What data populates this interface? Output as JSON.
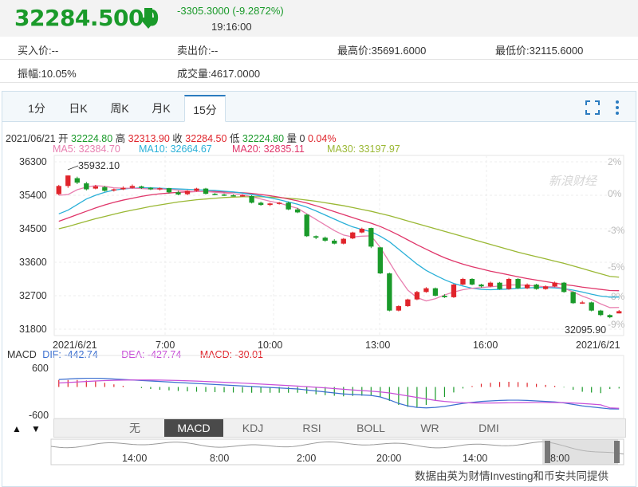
{
  "quote": {
    "price": "32284.5000",
    "change": "-3305.3000 (-9.2872%)",
    "time": "19:16:00"
  },
  "info": {
    "bid": "买入价:--",
    "ask": "卖出价:--",
    "high": "最高价:35691.6000",
    "low": "最低价:32115.6000",
    "amplitude": "振幅:10.05%",
    "volume": "成交量:4617.0000"
  },
  "tabs": [
    "1分",
    "日K",
    "周K",
    "月K",
    "15分"
  ],
  "active_tab": "15分",
  "ohlc": {
    "date": "2021/06/21",
    "open_label": "开",
    "open": "32224.80",
    "high_label": "高",
    "high": "32313.90",
    "close_label": "收",
    "close": "32284.50",
    "low_label": "低",
    "low": "32224.80",
    "vol_label": "量",
    "vol": "0",
    "pct": "0.04%"
  },
  "ma": {
    "ma5": "MA5: 32384.70",
    "ma10": "MA10: 32664.67",
    "ma20": "MA20: 32835.11",
    "ma30": "MA30: 33197.97"
  },
  "macd": {
    "title": "MACD",
    "dif": "DIF: -442.74",
    "dea": "DEA: -427.74",
    "macd": "MACD: -30.01",
    "ytick_top": "600",
    "ytick_bottom": "-600"
  },
  "indicators": [
    "无",
    "MACD",
    "KDJ",
    "RSI",
    "BOLL",
    "WR",
    "DMI"
  ],
  "active_indicator": "MACD",
  "nav_labels": [
    "14:00",
    "8:00",
    "2:00",
    "20:00",
    "14:00",
    "8:00"
  ],
  "footer": "数据由英为财情Investing和币安共同提供",
  "watermark": "新浪财经",
  "colors": {
    "up": "#e0242b",
    "down": "#1a9a2a",
    "ma5": "#e87fb0",
    "ma10": "#2ab0d8",
    "ma20": "#e0366a",
    "ma30": "#9ab834"
  },
  "chart_data": {
    "type": "candlestick",
    "y_ticks": [
      "36300",
      "35400",
      "34500",
      "33600",
      "32700",
      "31800"
    ],
    "y_pct_ticks": [
      "2%",
      "0%",
      "-3%",
      "-5%",
      "-8%",
      "-9%"
    ],
    "x_labels": [
      "2021/6/21",
      "7:00",
      "10:00",
      "13:00",
      "16:00",
      "2021/6/21"
    ],
    "annotations": [
      "35932.10",
      "32095.90"
    ],
    "ylim": [
      31800,
      36300
    ],
    "candles": [
      {
        "o": 35430,
        "c": 35650,
        "h": 35680,
        "l": 35400
      },
      {
        "o": 35650,
        "c": 35932,
        "h": 35932,
        "l": 35600
      },
      {
        "o": 35860,
        "c": 35740,
        "h": 35900,
        "l": 35700
      },
      {
        "o": 35720,
        "c": 35560,
        "h": 35760,
        "l": 35530
      },
      {
        "o": 35580,
        "c": 35640,
        "h": 35680,
        "l": 35560
      },
      {
        "o": 35620,
        "c": 35520,
        "h": 35650,
        "l": 35500
      },
      {
        "o": 35530,
        "c": 35560,
        "h": 35580,
        "l": 35500
      },
      {
        "o": 35560,
        "c": 35600,
        "h": 35640,
        "l": 35540
      },
      {
        "o": 35600,
        "c": 35650,
        "h": 35690,
        "l": 35580
      },
      {
        "o": 35640,
        "c": 35600,
        "h": 35660,
        "l": 35570
      },
      {
        "o": 35600,
        "c": 35560,
        "h": 35620,
        "l": 35540
      },
      {
        "o": 35560,
        "c": 35590,
        "h": 35610,
        "l": 35530
      },
      {
        "o": 35590,
        "c": 35480,
        "h": 35600,
        "l": 35450
      },
      {
        "o": 35480,
        "c": 35420,
        "h": 35520,
        "l": 35400
      },
      {
        "o": 35430,
        "c": 35520,
        "h": 35540,
        "l": 35400
      },
      {
        "o": 35520,
        "c": 35580,
        "h": 35600,
        "l": 35500
      },
      {
        "o": 35580,
        "c": 35440,
        "h": 35600,
        "l": 35420
      },
      {
        "o": 35440,
        "c": 35420,
        "h": 35460,
        "l": 35400
      },
      {
        "o": 35420,
        "c": 35400,
        "h": 35440,
        "l": 35380
      },
      {
        "o": 35400,
        "c": 35390,
        "h": 35420,
        "l": 35370
      },
      {
        "o": 35390,
        "c": 35400,
        "h": 35420,
        "l": 35360
      },
      {
        "o": 35380,
        "c": 35200,
        "h": 35400,
        "l": 35180
      },
      {
        "o": 35200,
        "c": 35140,
        "h": 35230,
        "l": 35120
      },
      {
        "o": 35140,
        "c": 35180,
        "h": 35200,
        "l": 35110
      },
      {
        "o": 35180,
        "c": 35200,
        "h": 35220,
        "l": 35150
      },
      {
        "o": 35200,
        "c": 35020,
        "h": 35230,
        "l": 35000
      },
      {
        "o": 35020,
        "c": 34940,
        "h": 35060,
        "l": 34920
      },
      {
        "o": 34880,
        "c": 34300,
        "h": 34900,
        "l": 34280
      },
      {
        "o": 34300,
        "c": 34260,
        "h": 34320,
        "l": 34220
      },
      {
        "o": 34260,
        "c": 34180,
        "h": 34290,
        "l": 34150
      },
      {
        "o": 34180,
        "c": 34100,
        "h": 34220,
        "l": 34080
      },
      {
        "o": 34100,
        "c": 34230,
        "h": 34250,
        "l": 34080
      },
      {
        "o": 34240,
        "c": 34400,
        "h": 34420,
        "l": 34220
      },
      {
        "o": 34400,
        "c": 34500,
        "h": 34530,
        "l": 34380
      },
      {
        "o": 34520,
        "c": 34020,
        "h": 34530,
        "l": 33980
      },
      {
        "o": 34000,
        "c": 33300,
        "h": 34010,
        "l": 33280
      },
      {
        "o": 33300,
        "c": 32300,
        "h": 33320,
        "l": 32280
      },
      {
        "o": 32300,
        "c": 32420,
        "h": 32440,
        "l": 32280
      },
      {
        "o": 32420,
        "c": 32600,
        "h": 32620,
        "l": 32400
      },
      {
        "o": 32600,
        "c": 32800,
        "h": 32830,
        "l": 32580
      },
      {
        "o": 32800,
        "c": 32900,
        "h": 32930,
        "l": 32780
      },
      {
        "o": 32900,
        "c": 32700,
        "h": 32920,
        "l": 32680
      },
      {
        "o": 32700,
        "c": 32660,
        "h": 32740,
        "l": 32640
      },
      {
        "o": 32660,
        "c": 33000,
        "h": 33020,
        "l": 32640
      },
      {
        "o": 33000,
        "c": 33150,
        "h": 33180,
        "l": 32980
      },
      {
        "o": 33150,
        "c": 33000,
        "h": 33170,
        "l": 32980
      },
      {
        "o": 33000,
        "c": 32950,
        "h": 33020,
        "l": 32920
      },
      {
        "o": 32950,
        "c": 33050,
        "h": 33080,
        "l": 32930
      },
      {
        "o": 33050,
        "c": 32880,
        "h": 33070,
        "l": 32860
      },
      {
        "o": 32880,
        "c": 33150,
        "h": 33180,
        "l": 32860
      },
      {
        "o": 33150,
        "c": 32900,
        "h": 33170,
        "l": 32880
      },
      {
        "o": 32900,
        "c": 33000,
        "h": 33030,
        "l": 32880
      },
      {
        "o": 33000,
        "c": 32880,
        "h": 33020,
        "l": 32860
      },
      {
        "o": 32880,
        "c": 32950,
        "h": 32980,
        "l": 32860
      },
      {
        "o": 32950,
        "c": 33050,
        "h": 33080,
        "l": 32930
      },
      {
        "o": 33050,
        "c": 32800,
        "h": 33070,
        "l": 32780
      },
      {
        "o": 32800,
        "c": 32500,
        "h": 32820,
        "l": 32480
      },
      {
        "o": 32500,
        "c": 32520,
        "h": 32560,
        "l": 32480
      },
      {
        "o": 32520,
        "c": 32300,
        "h": 32540,
        "l": 32280
      },
      {
        "o": 32300,
        "c": 32180,
        "h": 32320,
        "l": 32150
      },
      {
        "o": 32180,
        "c": 32120,
        "h": 32200,
        "l": 32095
      },
      {
        "o": 32224,
        "c": 32284,
        "h": 32314,
        "l": 32224
      }
    ],
    "ma5": [
      35400,
      35420,
      35550,
      35620,
      35660,
      35640,
      35600,
      35590,
      35590,
      35580,
      35570,
      35570,
      35560,
      35540,
      35510,
      35500,
      35500,
      35480,
      35460,
      35440,
      35420,
      35360,
      35300,
      35240,
      35190,
      35120,
      35050,
      34900,
      34750,
      34600,
      34450,
      34330,
      34280,
      34300,
      34310,
      34000,
      33600,
      33200,
      32850,
      32650,
      32560,
      32620,
      32720,
      32800,
      32860,
      32900,
      32920,
      32940,
      32960,
      32990,
      32990,
      32980,
      32960,
      32940,
      32940,
      32900,
      32800,
      32690,
      32600,
      32480,
      32380,
      32384
    ],
    "ma10": [
      34900,
      35000,
      35150,
      35300,
      35400,
      35480,
      35540,
      35570,
      35590,
      35600,
      35600,
      35590,
      35580,
      35570,
      35560,
      35550,
      35540,
      35530,
      35510,
      35490,
      35460,
      35420,
      35380,
      35330,
      35280,
      35220,
      35160,
      35080,
      34980,
      34870,
      34760,
      34650,
      34550,
      34480,
      34420,
      34300,
      34150,
      33950,
      33750,
      33550,
      33380,
      33250,
      33130,
      33030,
      32960,
      32900,
      32870,
      32860,
      32870,
      32880,
      32900,
      32910,
      32920,
      32920,
      32910,
      32890,
      32850,
      32800,
      32740,
      32690,
      32664,
      32664
    ],
    "ma20": [
      34700,
      34790,
      34880,
      34970,
      35060,
      35140,
      35210,
      35270,
      35320,
      35370,
      35410,
      35440,
      35460,
      35480,
      35490,
      35500,
      35500,
      35500,
      35490,
      35480,
      35470,
      35450,
      35420,
      35390,
      35350,
      35300,
      35250,
      35190,
      35120,
      35040,
      34960,
      34880,
      34800,
      34720,
      34650,
      34560,
      34450,
      34330,
      34200,
      34070,
      33950,
      33830,
      33720,
      33630,
      33550,
      33480,
      33420,
      33360,
      33310,
      33260,
      33210,
      33160,
      33120,
      33080,
      33040,
      33000,
      32970,
      32930,
      32900,
      32870,
      32840,
      32835
    ],
    "ma30": [
      34500,
      34560,
      34630,
      34700,
      34770,
      34830,
      34890,
      34950,
      35000,
      35050,
      35100,
      35140,
      35180,
      35220,
      35250,
      35280,
      35300,
      35320,
      35340,
      35350,
      35360,
      35360,
      35360,
      35350,
      35340,
      35320,
      35300,
      35270,
      35240,
      35200,
      35160,
      35120,
      35070,
      35020,
      34970,
      34910,
      34850,
      34780,
      34710,
      34640,
      34570,
      34500,
      34430,
      34360,
      34290,
      34220,
      34150,
      34080,
      34010,
      33940,
      33870,
      33810,
      33750,
      33690,
      33630,
      33570,
      33500,
      33430,
      33360,
      33290,
      33220,
      33198
    ],
    "macd_dif": [
      150,
      160,
      170,
      175,
      175,
      170,
      160,
      150,
      140,
      130,
      120,
      110,
      100,
      90,
      80,
      70,
      60,
      50,
      40,
      30,
      20,
      10,
      0,
      -10,
      -20,
      -30,
      -40,
      -60,
      -80,
      -100,
      -120,
      -140,
      -150,
      -160,
      -170,
      -200,
      -260,
      -330,
      -380,
      -410,
      -420,
      -410,
      -390,
      -360,
      -330,
      -310,
      -290,
      -280,
      -270,
      -265,
      -265,
      -270,
      -280,
      -290,
      -300,
      -320,
      -350,
      -380,
      -400,
      -420,
      -440,
      -443
    ],
    "macd_dea": [
      80,
      90,
      100,
      110,
      120,
      128,
      134,
      138,
      140,
      141,
      140,
      138,
      134,
      130,
      124,
      118,
      110,
      102,
      94,
      86,
      77,
      68,
      58,
      48,
      38,
      28,
      18,
      6,
      -6,
      -18,
      -32,
      -46,
      -60,
      -72,
      -84,
      -100,
      -120,
      -150,
      -180,
      -210,
      -240,
      -270,
      -290,
      -305,
      -315,
      -320,
      -322,
      -322,
      -320,
      -317,
      -314,
      -312,
      -311,
      -311,
      -312,
      -315,
      -322,
      -332,
      -344,
      -358,
      -420,
      -428
    ]
  }
}
